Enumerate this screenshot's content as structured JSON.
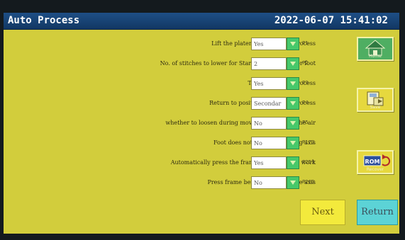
{
  "header": {
    "title": "Auto Process",
    "datetime": "2022-06-07 15:41:02"
  },
  "params": [
    {
      "label": "Lift the platen up after auto process",
      "value": "Yes",
      "param": "P1"
    },
    {
      "label": "No. of stitches to lower for Start and End  presser foot",
      "value": "2",
      "param": "P2"
    },
    {
      "label": "Trim after auto process",
      "value": "Yes",
      "param": "P3"
    },
    {
      "label": "Return to position after auto process",
      "value": "Secondar",
      "param": "P4"
    },
    {
      "label": "whether to loosen  during movement through the air",
      "value": "No",
      "param": "P5"
    },
    {
      "label": "Foot does not lift when moving axis",
      "value": "No",
      "param": "P173"
    },
    {
      "label": "Automatically press the frame when starting work",
      "value": "Yes",
      "param": "P259"
    },
    {
      "label": "Press frame before manual move axis",
      "value": "No",
      "param": "P260"
    }
  ],
  "side": {
    "home_label": "Home",
    "save_label": "Save",
    "rom_text": "ROM",
    "rom_label": "Recover"
  },
  "nav": {
    "next_label": "Next",
    "return_label": "Return"
  },
  "colors": {
    "screen_bg": "#d2cd3c",
    "title_bar": "#1e4f86",
    "dropdown_green": "#47c86a",
    "next_yellow": "#f3ea3c",
    "return_cyan": "#5cd3d6"
  }
}
